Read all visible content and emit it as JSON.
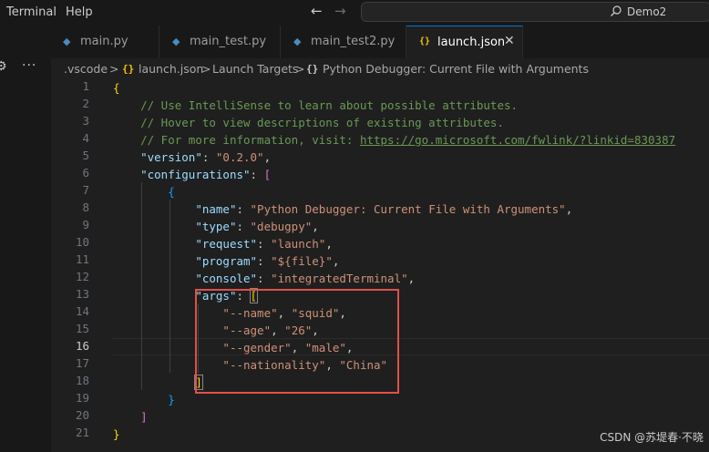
{
  "menu": {
    "items": [
      "Terminal",
      "Help"
    ]
  },
  "search": {
    "text": "Demo2"
  },
  "tabs": [
    {
      "label": "main.py",
      "icon": "python-file-icon",
      "active": false
    },
    {
      "label": "main_test.py",
      "icon": "python-file-icon",
      "active": false
    },
    {
      "label": "main_test2.py",
      "icon": "python-file-icon",
      "active": false
    },
    {
      "label": "launch.json",
      "icon": "json-file-icon",
      "active": true
    }
  ],
  "breadcrumb": {
    "folder": ".vscode",
    "file": "launch.json",
    "section": "Launch Targets",
    "item": "Python Debugger: Current File with Arguments",
    "separator": ">"
  },
  "editor": {
    "current_line": 16,
    "line_numbers": [
      "1",
      "2",
      "3",
      "4",
      "5",
      "6",
      "7",
      "8",
      "9",
      "10",
      "11",
      "12",
      "13",
      "14",
      "15",
      "16",
      "17",
      "18",
      "19",
      "20",
      "21"
    ],
    "lines": [
      [
        [
          "b1",
          "{"
        ]
      ],
      [
        [
          "p",
          "    "
        ],
        [
          "c",
          "// Use IntelliSense to learn about possible attributes."
        ]
      ],
      [
        [
          "p",
          "    "
        ],
        [
          "c",
          "// Hover to view descriptions of existing attributes."
        ]
      ],
      [
        [
          "p",
          "    "
        ],
        [
          "c",
          "// For more information, visit: "
        ],
        [
          "u",
          "https://go.microsoft.com/fwlink/?linkid=830387"
        ]
      ],
      [
        [
          "p",
          "    "
        ],
        [
          "k",
          "\"version\""
        ],
        [
          "p",
          ": "
        ],
        [
          "s",
          "\"0.2.0\""
        ],
        [
          "p",
          ","
        ]
      ],
      [
        [
          "p",
          "    "
        ],
        [
          "k",
          "\"configurations\""
        ],
        [
          "p",
          ": "
        ],
        [
          "b2",
          "["
        ]
      ],
      [
        [
          "p",
          "        "
        ],
        [
          "b3",
          "{"
        ]
      ],
      [
        [
          "p",
          "            "
        ],
        [
          "k",
          "\"name\""
        ],
        [
          "p",
          ": "
        ],
        [
          "s",
          "\"Python Debugger: Current File with Arguments\""
        ],
        [
          "p",
          ","
        ]
      ],
      [
        [
          "p",
          "            "
        ],
        [
          "k",
          "\"type\""
        ],
        [
          "p",
          ": "
        ],
        [
          "s",
          "\"debugpy\""
        ],
        [
          "p",
          ","
        ]
      ],
      [
        [
          "p",
          "            "
        ],
        [
          "k",
          "\"request\""
        ],
        [
          "p",
          ": "
        ],
        [
          "s",
          "\"launch\""
        ],
        [
          "p",
          ","
        ]
      ],
      [
        [
          "p",
          "            "
        ],
        [
          "k",
          "\"program\""
        ],
        [
          "p",
          ": "
        ],
        [
          "s",
          "\"${file}\""
        ],
        [
          "p",
          ","
        ]
      ],
      [
        [
          "p",
          "            "
        ],
        [
          "k",
          "\"console\""
        ],
        [
          "p",
          ": "
        ],
        [
          "s",
          "\"integratedTerminal\""
        ],
        [
          "p",
          ","
        ]
      ],
      [
        [
          "p",
          "            "
        ],
        [
          "k",
          "\"args\""
        ],
        [
          "p",
          ": "
        ],
        [
          "b1 bm",
          "["
        ]
      ],
      [
        [
          "p",
          "                "
        ],
        [
          "s",
          "\"--name\""
        ],
        [
          "p",
          ", "
        ],
        [
          "s",
          "\"squid\""
        ],
        [
          "p",
          ","
        ]
      ],
      [
        [
          "p",
          "                "
        ],
        [
          "s",
          "\"--age\""
        ],
        [
          "p",
          ", "
        ],
        [
          "s",
          "\"26\""
        ],
        [
          "p",
          ","
        ]
      ],
      [
        [
          "p",
          "                "
        ],
        [
          "s",
          "\"--gender\""
        ],
        [
          "p",
          ", "
        ],
        [
          "s",
          "\"male\""
        ],
        [
          "p",
          ","
        ]
      ],
      [
        [
          "p",
          "                "
        ],
        [
          "s",
          "\"--nationality\""
        ],
        [
          "p",
          ", "
        ],
        [
          "s",
          "\"China\""
        ]
      ],
      [
        [
          "p",
          "            "
        ],
        [
          "b1 bm",
          "]"
        ]
      ],
      [
        [
          "p",
          "        "
        ],
        [
          "b3",
          "}"
        ]
      ],
      [
        [
          "p",
          "    "
        ],
        [
          "b2",
          "]"
        ]
      ],
      [
        [
          "b1",
          "}"
        ]
      ]
    ]
  },
  "watermark": "CSDN @苏堤春·不晓",
  "colors": {
    "accent": "#0078d4",
    "highlight_box": "#e0504a",
    "json_key": "#9cdcfe",
    "json_string": "#ce9178",
    "comment": "#6a9955"
  }
}
